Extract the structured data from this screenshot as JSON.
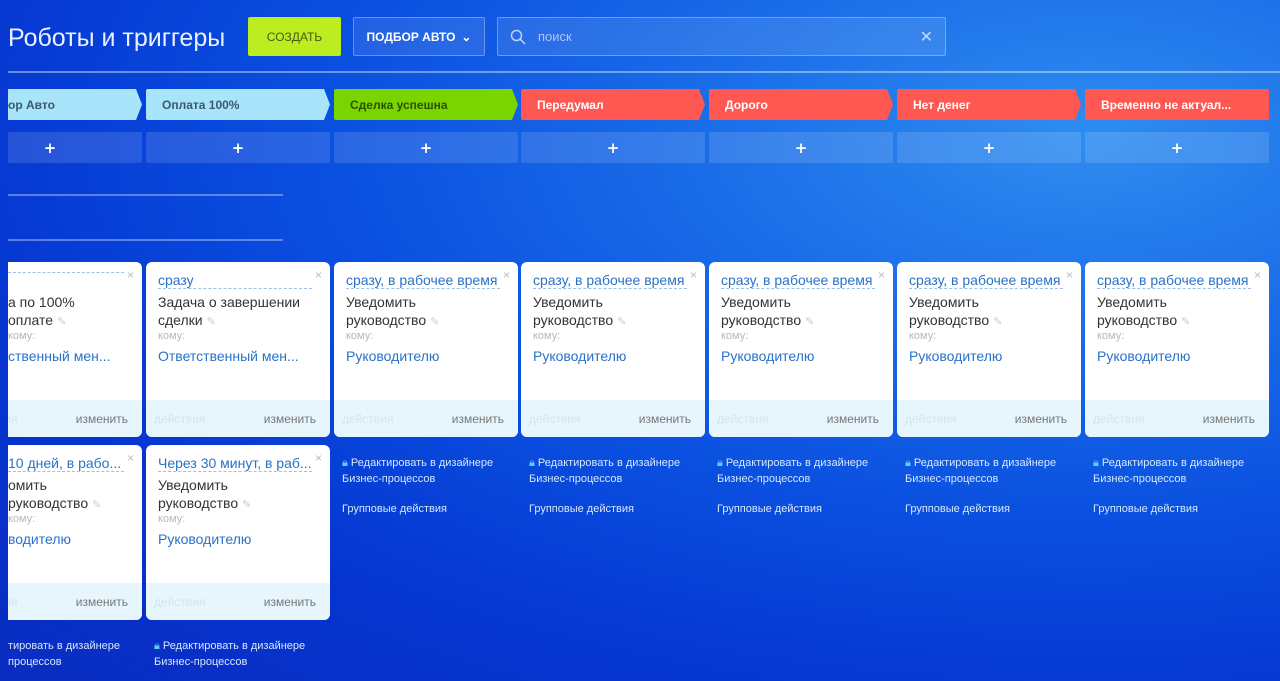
{
  "header": {
    "title": "Роботы и триггеры",
    "create_label": "СОЗДАТЬ",
    "pipeline_label": "ПОДБОР АВТО",
    "search_placeholder": "поиск"
  },
  "stages": [
    {
      "label": "ор Авто",
      "color": "#a8e4fa",
      "text_color": "#3a5a6a"
    },
    {
      "label": "Оплата 100%",
      "color": "#a8e4fa",
      "text_color": "#3a5a6a"
    },
    {
      "label": "Сделка успешна",
      "color": "#7ad400",
      "text_color": "#2d5000"
    },
    {
      "label": "Передумал",
      "color": "#ff5752",
      "text_color": "#ffffff"
    },
    {
      "label": "Дорого",
      "color": "#ff5752",
      "text_color": "#ffffff"
    },
    {
      "label": "Нет денег",
      "color": "#ff5752",
      "text_color": "#ffffff"
    },
    {
      "label": "Временно не актуал...",
      "color": "#ff5752",
      "text_color": "#ffffff"
    }
  ],
  "add_label": "+",
  "card_common": {
    "whom_label": "кому:",
    "actions_label": "действия",
    "edit_label": "изменить",
    "close": "×"
  },
  "links": {
    "designer_line1": "Редактировать в дизайнере",
    "designer_line2": "Бизнес-процессов",
    "designer_partial_line1": "тировать в дизайнере",
    "designer_partial_line2": "процессов",
    "group_actions": "Групповые действия"
  },
  "columns": [
    {
      "cards": [
        {
          "when": "",
          "name": "а по 100% оплате",
          "responsible": "ственный мен..."
        },
        {
          "when": " 10 дней, в рабо...",
          "name": "омить руководство",
          "responsible": "водителю"
        }
      ]
    },
    {
      "cards": [
        {
          "when": "сразу",
          "name": "Задача о завершении сделки",
          "responsible": "Ответственный мен..."
        },
        {
          "when": "Через 30 минут, в раб...",
          "name": "Уведомить руководство",
          "responsible": "Руководителю"
        }
      ]
    },
    {
      "cards": [
        {
          "when": "сразу, в рабочее время",
          "name": "Уведомить руководство",
          "responsible": "Руководителю"
        }
      ]
    },
    {
      "cards": [
        {
          "when": "сразу, в рабочее время",
          "name": "Уведомить руководство",
          "responsible": "Руководителю"
        }
      ]
    },
    {
      "cards": [
        {
          "when": "сразу, в рабочее время",
          "name": "Уведомить руководство",
          "responsible": "Руководителю"
        }
      ]
    },
    {
      "cards": [
        {
          "when": "сразу, в рабочее время",
          "name": "Уведомить руководство",
          "responsible": "Руководителю"
        }
      ]
    },
    {
      "cards": [
        {
          "when": "сразу, в рабочее время",
          "name": "Уведомить руководство",
          "responsible": "Руководителю"
        }
      ]
    }
  ]
}
